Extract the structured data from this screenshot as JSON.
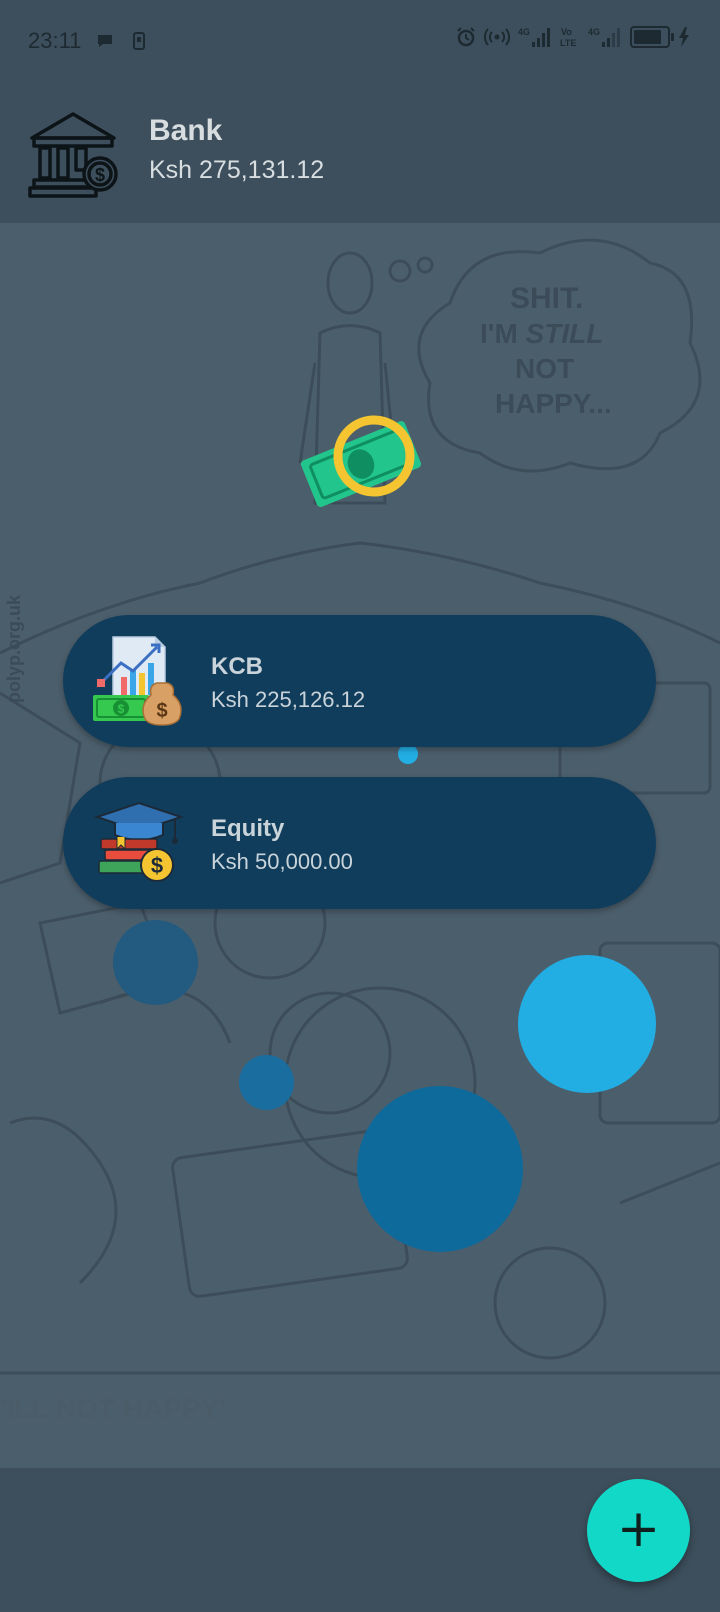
{
  "status_bar": {
    "time": "23:11",
    "left_icons": [
      "chat-bubble-icon",
      "phone-icon"
    ],
    "right_icons": [
      "alarm-icon",
      "hotspot-icon",
      "signal-4g-icon",
      "volte-icon",
      "signal-4g-icon-2",
      "battery-icon",
      "charging-icon"
    ],
    "network_1": "4G",
    "volte": "Vo LTE",
    "network_2": "4G",
    "battery_level": 0.85
  },
  "header": {
    "title": "Bank",
    "total_amount": "Ksh 275,131.12",
    "icon": "bank-building-icon"
  },
  "background_text": {
    "thought_bubble": "SHIT. I'M STILL NOT HAPPY...",
    "caption": "'ILL NOT HAPPY'",
    "watermark": "polyp.org.uk"
  },
  "accounts": [
    {
      "name": "KCB",
      "amount": "Ksh 225,126.12",
      "icon": "chart-money-icon"
    },
    {
      "name": "Equity",
      "amount": "Ksh 50,000.00",
      "icon": "education-money-icon"
    }
  ],
  "center_icon": "money-cash-icon",
  "fab": {
    "label": "+",
    "icon": "add-icon"
  },
  "colors": {
    "header_bg": "#3d4f5c",
    "card_bg": "#113d5c",
    "fab": "#12d9c7",
    "bubble_light": "#22aee3",
    "bubble_mid": "#0f6a9c",
    "bubble_dark": "#235a80"
  }
}
